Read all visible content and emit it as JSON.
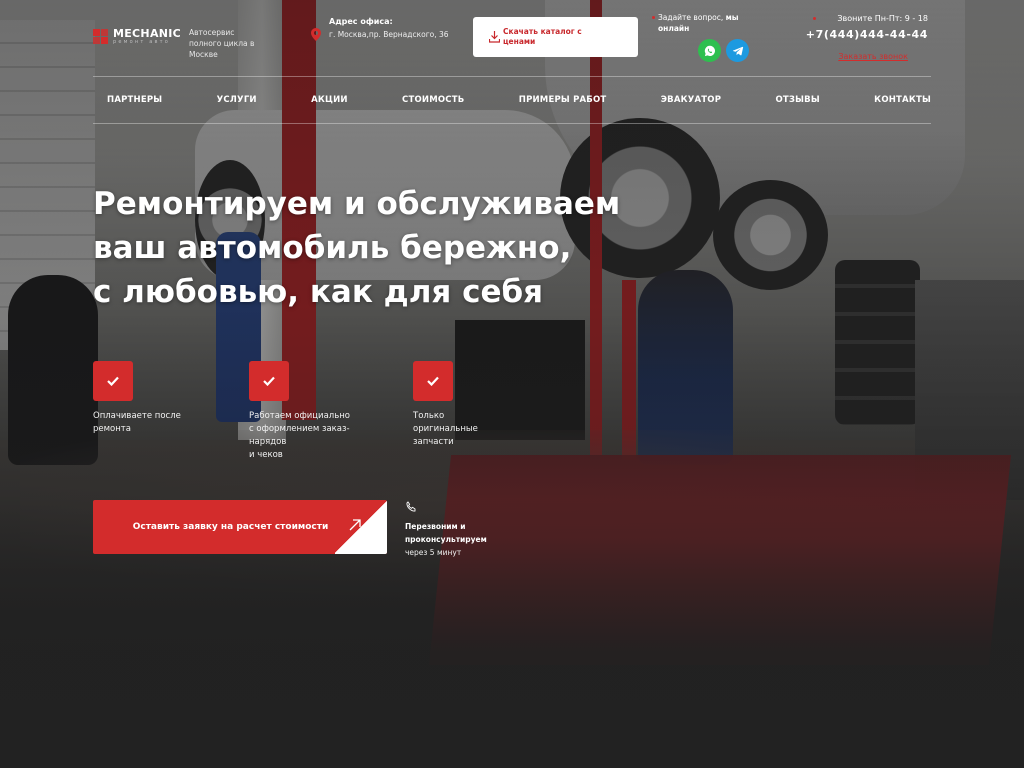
{
  "brand": {
    "name": "MECHANIC",
    "subtitle": "ремонт авто",
    "tagline": "Автосервис полного цикла в Москве"
  },
  "address": {
    "title": "Адрес офиса:",
    "text": "г. Москва,пр. Вернадского, 36"
  },
  "catalog_button": "Скачать каталог с ценами",
  "ask": {
    "prefix": "Задайте вопрос,",
    "bold": "мы онлайн"
  },
  "messengers": [
    {
      "name": "WhatsApp",
      "icon": "whatsapp-icon",
      "color": "#2ebf4f"
    },
    {
      "name": "Telegram",
      "icon": "telegram-icon",
      "color": "#1d9ae0"
    }
  ],
  "contacts": {
    "hours": "Звоните Пн-Пт: 9 - 18",
    "phone": "+7(444)444-44-44",
    "callback_link": "Заказать звонок"
  },
  "nav": {
    "items": [
      "ПАРТНЕРЫ",
      "УСЛУГИ",
      "АКЦИИ",
      "СТОИМОСТЬ",
      "ПРИМЕРЫ РАБОТ",
      "ЭВАКУАТОР",
      "ОТЗЫВЫ",
      "КОНТАКТЫ"
    ]
  },
  "hero": {
    "title_lines": [
      "Ремонтируем и обслуживаем",
      "ваш автомобиль бережно,",
      "с любовью, как для себя"
    ],
    "features": [
      {
        "text": "Оплачиваете после\nремонта"
      },
      {
        "text": "Работаем официально\nс оформлением заказ-\nнарядов\nи чеков"
      },
      {
        "text": "Только\nоригинальные\nзапчасти"
      }
    ],
    "cta_label": "Оставить заявку на расчет стоимости",
    "callback_note": {
      "line1": "Перезвоним и проконсультируем",
      "line2": "через 5 минут"
    }
  },
  "colors": {
    "accent": "#d32c2c",
    "text": "#ffffff",
    "whatsapp": "#2ebf4f",
    "telegram": "#1d9ae0"
  }
}
